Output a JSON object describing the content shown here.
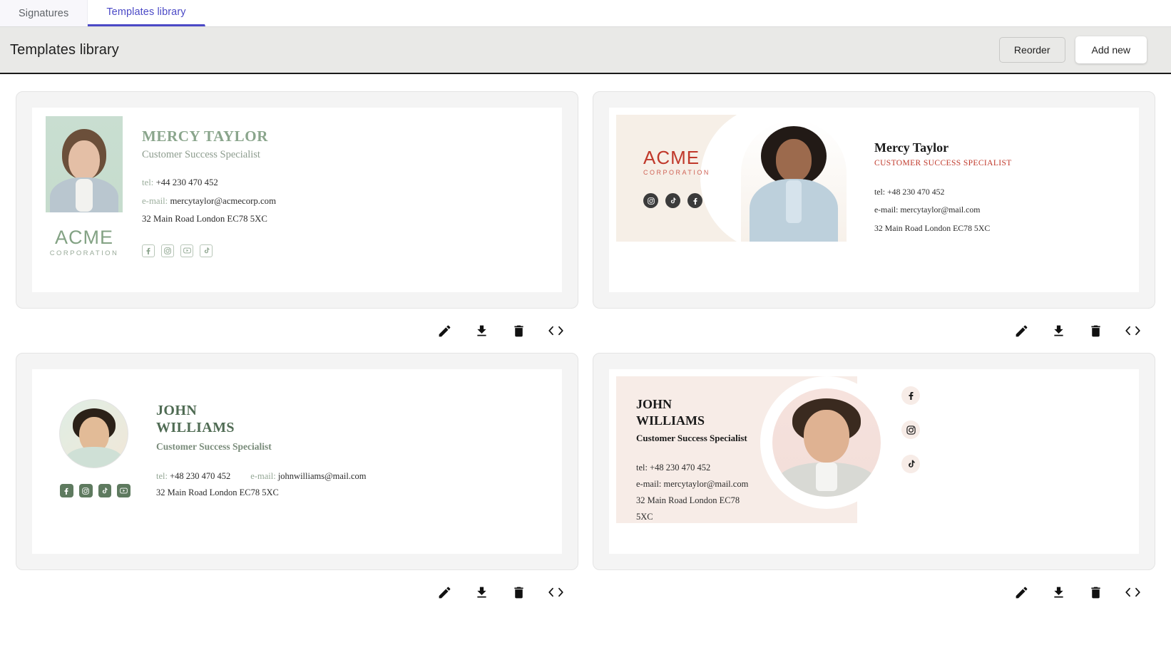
{
  "tabs": [
    {
      "label": "Signatures",
      "active": false
    },
    {
      "label": "Templates library",
      "active": true
    }
  ],
  "header": {
    "title": "Templates library",
    "reorder_label": "Reorder",
    "add_new_label": "Add new"
  },
  "toolbar_icons": [
    {
      "name": "edit-icon",
      "title": "Edit"
    },
    {
      "name": "download-icon",
      "title": "Download"
    },
    {
      "name": "delete-icon",
      "title": "Delete"
    },
    {
      "name": "code-icon",
      "title": "Source code"
    }
  ],
  "colors": {
    "accent": "#4b49c6",
    "header_bg": "#e9e9e7",
    "card_bg": "#f4f4f4",
    "sig1_green": "#8aa58c",
    "sig2_red": "#c0392b",
    "sig2_cream": "#f6efe7",
    "sig3_green": "#4f6b53",
    "sig4_blush": "#f7ece7"
  },
  "templates": [
    {
      "id": "template-1",
      "name": "MERCY TAYLOR",
      "title": "Customer Success Specialist",
      "tel_label": "tel:",
      "tel": "+44 230 470 452",
      "email_label": "e-mail:",
      "email": "mercytaylor@acmecorp.com",
      "address": "32 Main Road London EC78 5XC",
      "logo_primary": "ACME",
      "logo_secondary": "CORPORATION",
      "socials": [
        "facebook-icon",
        "instagram-icon",
        "youtube-icon",
        "tiktok-icon"
      ]
    },
    {
      "id": "template-2",
      "name": "Mercy Taylor",
      "title": "CUSTOMER SUCCESS SPECIALIST",
      "tel_line": "tel: +48 230 470 452",
      "email_line": "e-mail: mercytaylor@mail.com",
      "address": "32 Main Road London EC78 5XC",
      "logo_primary": "ACME",
      "logo_secondary": "CORPORATION",
      "socials": [
        "instagram-icon",
        "tiktok-icon",
        "facebook-icon"
      ]
    },
    {
      "id": "template-3",
      "name_line1": "JOHN",
      "name_line2": "WILLIAMS",
      "title": "Customer Success Specialist",
      "tel_label": "tel:",
      "tel": "+48 230 470 452",
      "email_label": "e-mail:",
      "email": "johnwilliams@mail.com",
      "address": "32 Main Road London EC78 5XC",
      "socials": [
        "facebook-icon",
        "instagram-icon",
        "tiktok-icon",
        "youtube-icon"
      ]
    },
    {
      "id": "template-4",
      "name_line1": "JOHN",
      "name_line2": "WILLIAMS",
      "title": "Customer Success Specialist",
      "tel_line": "tel: +48 230 470 452",
      "email_line": "e-mail: mercytaylor@mail.com",
      "address": "32 Main Road London EC78 5XC",
      "socials": [
        "facebook-icon",
        "instagram-icon",
        "tiktok-icon"
      ]
    }
  ]
}
